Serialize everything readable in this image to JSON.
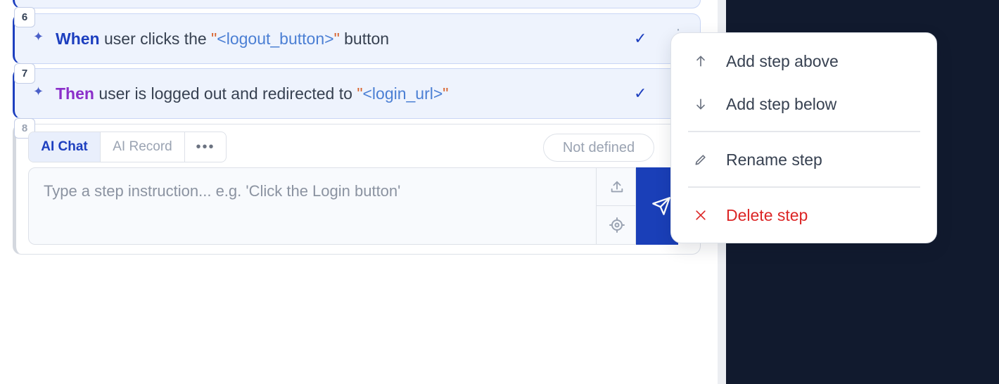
{
  "steps": [
    {
      "number": "6",
      "keyword": "When",
      "text_before": " user clicks the ",
      "quote_open": "\"",
      "param": "<logout_button>",
      "quote_close": "\"",
      "text_after": " button",
      "status": "done"
    },
    {
      "number": "7",
      "keyword": "Then",
      "text_before": " user is logged out and redirected to ",
      "quote_open": "\"",
      "param": "<login_url>",
      "quote_close": "\"",
      "text_after": "",
      "status": "done"
    }
  ],
  "new_step": {
    "number": "8",
    "tabs": [
      {
        "label": "AI Chat",
        "active": true
      },
      {
        "label": "AI Record",
        "active": false
      },
      {
        "label": "•••",
        "active": false
      }
    ],
    "status_label": "Not defined",
    "input_placeholder": "Type a step instruction... e.g. 'Click the Login button'",
    "icons": [
      "upload-icon",
      "target-icon",
      "send-icon"
    ]
  },
  "context_menu": {
    "items": [
      {
        "label": "Add step above",
        "icon": "arrow-up-icon"
      },
      {
        "label": "Add step below",
        "icon": "arrow-down-icon"
      },
      {
        "label": "Rename step",
        "icon": "pencil-icon"
      },
      {
        "label": "Delete step",
        "icon": "close-icon",
        "danger": true
      }
    ]
  },
  "colors": {
    "accent": "#1d3fbf",
    "then_keyword": "#8b2fc9",
    "quote": "#d9622b",
    "param": "#4b7fd4",
    "danger": "#dc2626",
    "dark_pane": "#111a2e"
  }
}
